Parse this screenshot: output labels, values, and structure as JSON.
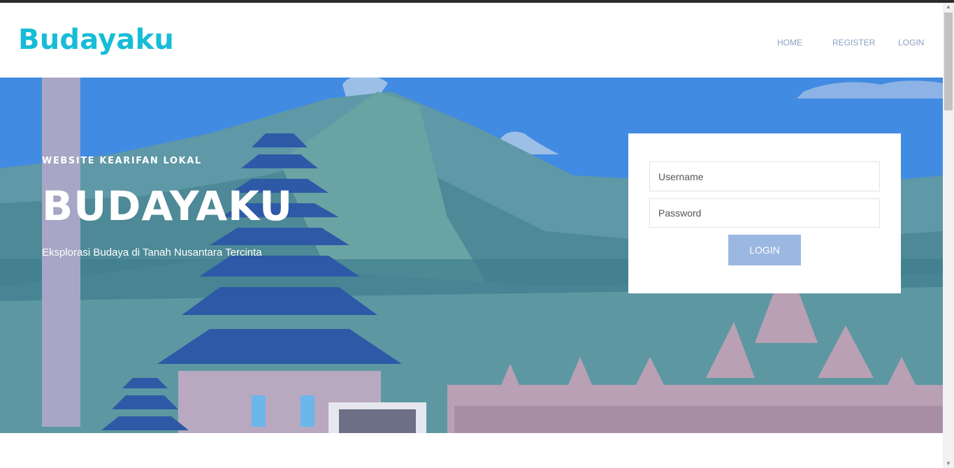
{
  "header": {
    "brand": "Budayaku",
    "nav": [
      "HOME",
      "REGISTER",
      "LOGIN"
    ]
  },
  "hero": {
    "eyebrow": "WEBSITE KEARIFAN LOKAL",
    "title": "BUDAYAKU",
    "subtitle": "Eksplorasi Budaya di Tanah Nusantara Tercinta"
  },
  "login_form": {
    "username_placeholder": "Username",
    "password_placeholder": "Password",
    "button_label": "LOGIN"
  },
  "colors": {
    "brand": "#17bcd6",
    "nav": "#8aa0c2",
    "sky": "#428be2",
    "button": "#9bb8e2"
  }
}
